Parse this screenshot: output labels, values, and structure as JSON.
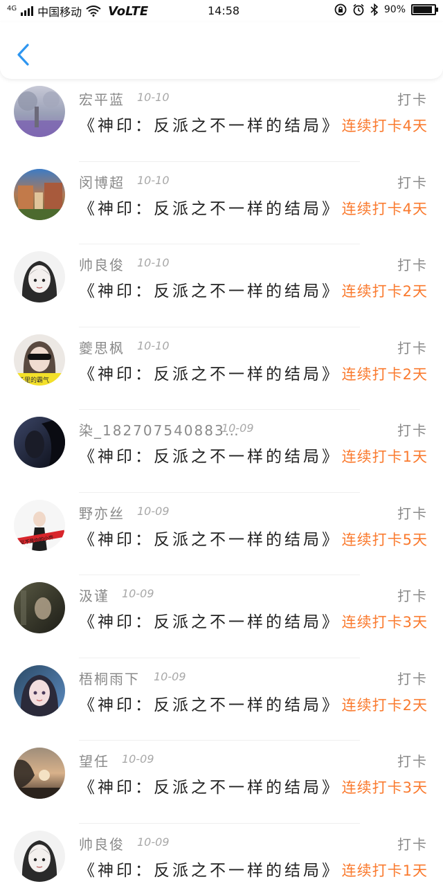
{
  "status_bar": {
    "network": "4G",
    "carrier": "中国移动",
    "volte": "VoLTE",
    "time": "14:58",
    "battery_percent": "90%",
    "battery_level": 0.9
  },
  "header": {
    "back_icon": "chevron-left-icon",
    "accent_color": "#2e96f0"
  },
  "items": [
    {
      "name": "宏平蓝",
      "date": "10-10",
      "action": "打卡",
      "book": "《神印：反派之不一样的结局》",
      "streak": "连续打卡4天"
    },
    {
      "name": "闵博超",
      "date": "10-10",
      "action": "打卡",
      "book": "《神印：反派之不一样的结局》",
      "streak": "连续打卡4天"
    },
    {
      "name": "帅良俊",
      "date": "10-10",
      "action": "打卡",
      "book": "《神印：反派之不一样的结局》",
      "streak": "连续打卡2天"
    },
    {
      "name": "夔思枫",
      "date": "10-10",
      "action": "打卡",
      "book": "《神印：反派之不一样的结局》",
      "streak": "连续打卡2天"
    },
    {
      "name": "染_182707540883…",
      "date": "10-09",
      "action": "打卡",
      "book": "《神印：反派之不一样的结局》",
      "streak": "连续打卡1天"
    },
    {
      "name": "野亦丝",
      "date": "10-09",
      "action": "打卡",
      "book": "《神印：反派之不一样的结局》",
      "streak": "连续打卡5天"
    },
    {
      "name": "汲谨",
      "date": "10-09",
      "action": "打卡",
      "book": "《神印：反派之不一样的结局》",
      "streak": "连续打卡3天"
    },
    {
      "name": "梧桐雨下",
      "date": "10-09",
      "action": "打卡",
      "book": "《神印：反派之不一样的结局》",
      "streak": "连续打卡2天"
    },
    {
      "name": "望任",
      "date": "10-09",
      "action": "打卡",
      "book": "《神印：反派之不一样的结局》",
      "streak": "连续打卡3天"
    },
    {
      "name": "帅良俊",
      "date": "10-09",
      "action": "打卡",
      "book": "《神印：反派之不一样的结局》",
      "streak": "连续打卡1天"
    }
  ],
  "colors": {
    "streak": "#fa7a2e",
    "meta_text": "#8a8a8a",
    "book_text": "#222222"
  }
}
